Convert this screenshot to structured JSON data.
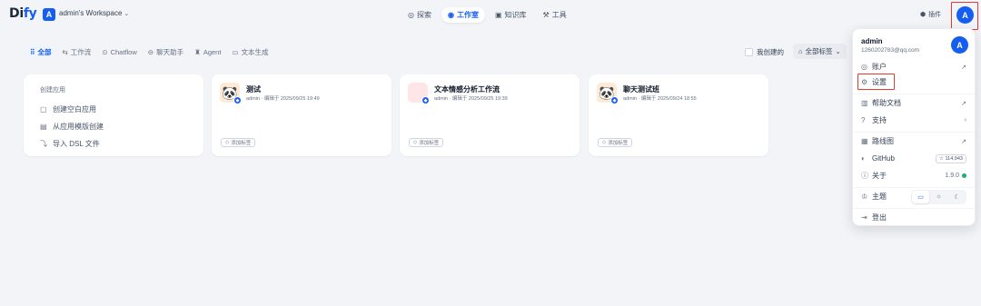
{
  "header": {
    "logo_prefix": "Di",
    "logo_suffix": "fy",
    "workspace_badge": "A",
    "workspace_name": "admin's Workspace",
    "nav": [
      {
        "label": "探索",
        "icon": "compass-icon",
        "active": false
      },
      {
        "label": "工作室",
        "icon": "robot-icon",
        "active": true
      },
      {
        "label": "知识库",
        "icon": "book-icon",
        "active": false
      },
      {
        "label": "工具",
        "icon": "hammer-icon",
        "active": false
      }
    ],
    "plugin_label": "插件",
    "avatar_letter": "A"
  },
  "filters": {
    "tabs": [
      {
        "label": "全部",
        "active": true
      },
      {
        "label": "工作流",
        "active": false
      },
      {
        "label": "Chatflow",
        "active": false
      },
      {
        "label": "聊天助手",
        "active": false
      },
      {
        "label": "Agent",
        "active": false
      },
      {
        "label": "文本生成",
        "active": false
      }
    ],
    "mine_label": "我创建的",
    "tag_filter_label": "全部标签"
  },
  "create_card": {
    "title": "创建应用",
    "items": [
      {
        "label": "创建空白应用",
        "icon": "file-plus-icon"
      },
      {
        "label": "从应用模版创建",
        "icon": "template-icon"
      },
      {
        "label": "导入 DSL 文件",
        "icon": "import-icon"
      }
    ]
  },
  "apps": [
    {
      "name": "测试",
      "meta": "admin · 编辑于 2025/09/25 19:49",
      "icon": "🐼",
      "icon_bg": "#ffead5",
      "tag_label": "添加标签"
    },
    {
      "name": "文本情感分析工作流",
      "meta": "admin · 编辑于 2025/09/25 19:39",
      "icon": "",
      "icon_bg": "#ffe4e8",
      "tag_label": "添加标签"
    },
    {
      "name": "聊天测试班",
      "meta": "admin · 编辑于 2025/09/24 18:55",
      "icon": "🐼",
      "icon_bg": "#ffead5",
      "tag_label": "添加标签"
    }
  ],
  "menu": {
    "user_name": "admin",
    "user_email": "1260202783@qq.com",
    "avatar_letter": "A",
    "account": "账户",
    "settings": "设置",
    "help_docs": "帮助文档",
    "support": "支持",
    "roadmap": "路线图",
    "github": "GitHub",
    "github_stars": "114,943",
    "about": "关于",
    "version": "1.9.0",
    "theme": "主题",
    "logout": "登出"
  },
  "colors": {
    "accent": "#155eef",
    "highlight_box": "#e8392f",
    "status_green": "#17b26a"
  }
}
